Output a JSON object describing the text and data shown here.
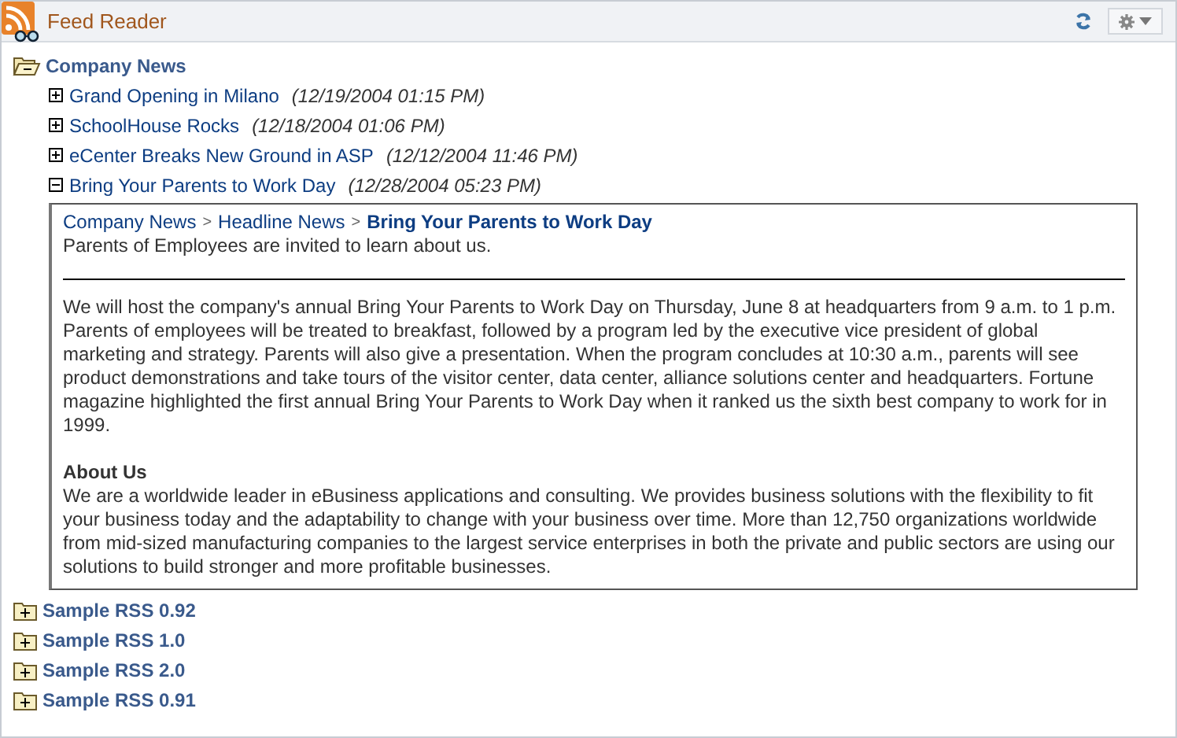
{
  "header": {
    "title": "Feed Reader"
  },
  "feeds": [
    {
      "title": "Company News",
      "expanded": true,
      "items": [
        {
          "title": "Grand Opening in Milano",
          "date": "(12/19/2004 01:15 PM)",
          "expanded": false
        },
        {
          "title": "SchoolHouse Rocks",
          "date": "(12/18/2004 01:06 PM)",
          "expanded": false
        },
        {
          "title": "eCenter Breaks New Ground in ASP",
          "date": "(12/12/2004 11:46 PM)",
          "expanded": false
        },
        {
          "title": "Bring Your Parents to Work Day",
          "date": "(12/28/2004 05:23 PM)",
          "expanded": true,
          "article": {
            "breadcrumb": [
              {
                "kind": "link",
                "text": "Company News"
              },
              {
                "kind": "separator",
                "text": ">"
              },
              {
                "kind": "link",
                "text": "Headline News"
              },
              {
                "kind": "separator",
                "text": ">"
              },
              {
                "kind": "current",
                "text": "Bring Your Parents to Work Day"
              }
            ],
            "summary": "Parents of Employees are invited to learn about us.",
            "body": "We will host the company's annual Bring Your Parents to Work Day on Thursday, June 8 at headquarters from 9 a.m. to 1 p.m. Parents of employees will be treated to breakfast, followed by a program led by the executive vice president of global marketing and strategy. Parents will also give a presentation. When the program concludes at 10:30 a.m., parents will see product demonstrations and take tours of the visitor center, data center, alliance solutions center and headquarters. Fortune magazine highlighted the first annual Bring Your Parents to Work Day when it ranked us the sixth best company to work for in 1999.",
            "section_heading": "About Us",
            "section_text": "We are a worldwide leader in eBusiness applications and consulting. We provides business solutions with the flexibility to fit your business today and the adaptability to change with your business over time. More than 12,750 organizations worldwide from mid-sized manufacturing companies to the largest service enterprises in both the private and public sectors are using our solutions to build stronger and more profitable businesses."
          }
        }
      ]
    },
    {
      "title": "Sample RSS 0.92",
      "expanded": false
    },
    {
      "title": "Sample RSS 1.0",
      "expanded": false
    },
    {
      "title": "Sample RSS 2.0",
      "expanded": false
    },
    {
      "title": "Sample RSS 0.91",
      "expanded": false
    }
  ]
}
